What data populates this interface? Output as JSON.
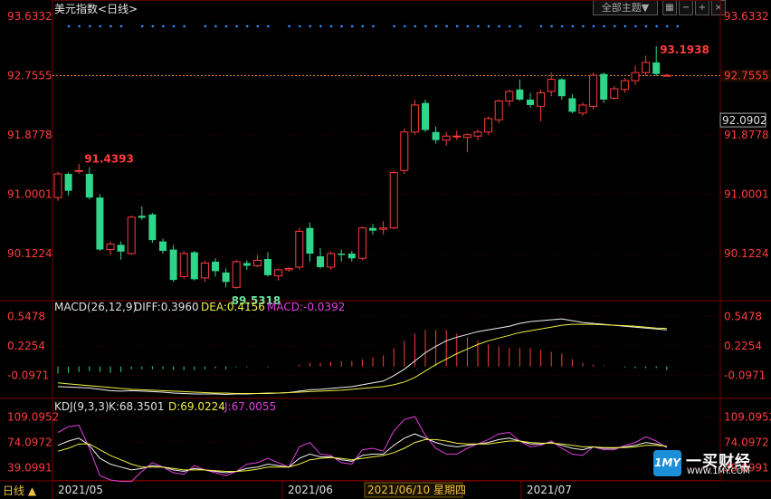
{
  "header": {
    "title": "美元指数",
    "period": "<日线>",
    "theme_button": "全部主题▼",
    "tool_icons": [
      "grid-icon",
      "minus-icon",
      "plus-icon",
      "close-icon"
    ]
  },
  "colors": {
    "up": "#ff3b3b",
    "down": "#2fd68a",
    "axis_text": "#ff3b3b",
    "grid": "#3a0000",
    "dot_markers": "#2f8fff",
    "diff_line": "#f0f0f0",
    "dea_line": "#f0f040",
    "j_line": "#e040e0",
    "last_price_line": "#e08a2a"
  },
  "chart_data": {
    "type": "candlestick",
    "main": {
      "y_labels": [
        "93.6332",
        "92.7555",
        "91.8778",
        "91.0001",
        "90.1224"
      ],
      "y_range": [
        89.45,
        93.6332
      ],
      "current_price": "92.7555",
      "reference_price": "92.0902",
      "high_annotation": "93.1938",
      "high_annotation_2": "91.4393",
      "low_annotation": "89.5318",
      "candles": [
        {
          "o": 90.95,
          "h": 91.33,
          "l": 90.9,
          "c": 91.3
        },
        {
          "o": 91.3,
          "h": 91.32,
          "l": 90.98,
          "c": 91.05
        },
        {
          "o": 91.35,
          "h": 91.45,
          "l": 91.3,
          "c": 91.35
        },
        {
          "o": 91.3,
          "h": 91.4,
          "l": 90.92,
          "c": 90.95
        },
        {
          "o": 90.95,
          "h": 91.0,
          "l": 90.16,
          "c": 90.18
        },
        {
          "o": 90.18,
          "h": 90.3,
          "l": 90.1,
          "c": 90.26
        },
        {
          "o": 90.25,
          "h": 90.3,
          "l": 90.03,
          "c": 90.15
        },
        {
          "o": 90.12,
          "h": 90.68,
          "l": 90.1,
          "c": 90.66
        },
        {
          "o": 90.68,
          "h": 90.82,
          "l": 90.62,
          "c": 90.65
        },
        {
          "o": 90.7,
          "h": 90.72,
          "l": 90.28,
          "c": 90.32
        },
        {
          "o": 90.3,
          "h": 90.34,
          "l": 90.12,
          "c": 90.16
        },
        {
          "o": 90.18,
          "h": 90.25,
          "l": 89.7,
          "c": 89.73
        },
        {
          "o": 89.78,
          "h": 90.16,
          "l": 89.75,
          "c": 90.12
        },
        {
          "o": 90.14,
          "h": 90.16,
          "l": 89.72,
          "c": 89.74
        },
        {
          "o": 89.76,
          "h": 90.02,
          "l": 89.7,
          "c": 89.98
        },
        {
          "o": 90.0,
          "h": 90.05,
          "l": 89.78,
          "c": 89.86
        },
        {
          "o": 89.84,
          "h": 89.9,
          "l": 89.62,
          "c": 89.7
        },
        {
          "o": 89.62,
          "h": 90.03,
          "l": 89.6,
          "c": 90.0
        },
        {
          "o": 89.98,
          "h": 90.02,
          "l": 89.88,
          "c": 89.94
        },
        {
          "o": 89.94,
          "h": 90.1,
          "l": 89.92,
          "c": 90.02
        },
        {
          "o": 90.04,
          "h": 90.14,
          "l": 89.78,
          "c": 89.8
        },
        {
          "o": 89.79,
          "h": 89.9,
          "l": 89.72,
          "c": 89.88
        },
        {
          "o": 89.88,
          "h": 89.92,
          "l": 89.85,
          "c": 89.9
        },
        {
          "o": 89.92,
          "h": 90.5,
          "l": 89.88,
          "c": 90.45
        },
        {
          "o": 90.5,
          "h": 90.58,
          "l": 90.0,
          "c": 90.12
        },
        {
          "o": 90.08,
          "h": 90.2,
          "l": 89.9,
          "c": 89.92
        },
        {
          "o": 89.92,
          "h": 90.15,
          "l": 89.88,
          "c": 90.12
        },
        {
          "o": 90.12,
          "h": 90.18,
          "l": 90.0,
          "c": 90.1
        },
        {
          "o": 90.12,
          "h": 90.16,
          "l": 90.0,
          "c": 90.05
        },
        {
          "o": 90.05,
          "h": 90.52,
          "l": 90.02,
          "c": 90.5
        },
        {
          "o": 90.5,
          "h": 90.56,
          "l": 90.4,
          "c": 90.46
        },
        {
          "o": 90.48,
          "h": 90.6,
          "l": 90.4,
          "c": 90.5
        },
        {
          "o": 90.5,
          "h": 91.35,
          "l": 90.48,
          "c": 91.32
        },
        {
          "o": 91.35,
          "h": 91.97,
          "l": 91.3,
          "c": 91.92
        },
        {
          "o": 91.92,
          "h": 92.4,
          "l": 91.88,
          "c": 92.32
        },
        {
          "o": 92.35,
          "h": 92.4,
          "l": 91.92,
          "c": 91.95
        },
        {
          "o": 91.92,
          "h": 92.0,
          "l": 91.75,
          "c": 91.8
        },
        {
          "o": 91.8,
          "h": 91.92,
          "l": 91.72,
          "c": 91.86
        },
        {
          "o": 91.86,
          "h": 91.94,
          "l": 91.8,
          "c": 91.86
        },
        {
          "o": 91.84,
          "h": 91.9,
          "l": 91.62,
          "c": 91.88
        },
        {
          "o": 91.86,
          "h": 91.96,
          "l": 91.8,
          "c": 91.92
        },
        {
          "o": 91.92,
          "h": 92.15,
          "l": 91.88,
          "c": 92.12
        },
        {
          "o": 92.1,
          "h": 92.4,
          "l": 92.05,
          "c": 92.38
        },
        {
          "o": 92.38,
          "h": 92.55,
          "l": 92.3,
          "c": 92.52
        },
        {
          "o": 92.55,
          "h": 92.7,
          "l": 92.38,
          "c": 92.4
        },
        {
          "o": 92.4,
          "h": 92.5,
          "l": 92.28,
          "c": 92.32
        },
        {
          "o": 92.3,
          "h": 92.55,
          "l": 92.08,
          "c": 92.5
        },
        {
          "o": 92.52,
          "h": 92.8,
          "l": 92.45,
          "c": 92.7
        },
        {
          "o": 92.7,
          "h": 92.72,
          "l": 92.4,
          "c": 92.45
        },
        {
          "o": 92.42,
          "h": 92.48,
          "l": 92.2,
          "c": 92.22
        },
        {
          "o": 92.2,
          "h": 92.36,
          "l": 92.16,
          "c": 92.32
        },
        {
          "o": 92.3,
          "h": 92.8,
          "l": 92.25,
          "c": 92.76
        },
        {
          "o": 92.78,
          "h": 92.8,
          "l": 92.35,
          "c": 92.4
        },
        {
          "o": 92.42,
          "h": 92.6,
          "l": 92.4,
          "c": 92.56
        },
        {
          "o": 92.55,
          "h": 92.72,
          "l": 92.5,
          "c": 92.68
        },
        {
          "o": 92.68,
          "h": 92.9,
          "l": 92.62,
          "c": 92.8
        },
        {
          "o": 92.8,
          "h": 93.05,
          "l": 92.75,
          "c": 92.95
        },
        {
          "o": 92.95,
          "h": 93.19,
          "l": 92.75,
          "c": 92.78
        },
        {
          "o": 92.76,
          "h": 92.78,
          "l": 92.74,
          "c": 92.76
        }
      ]
    },
    "macd": {
      "label": "MACD(26,12,9)",
      "diff_label": "DIFF:0.3960",
      "dea_label": "DEA:0.4156",
      "macd_label": "MACD:-0.0392",
      "y_labels": [
        "0.5478",
        "0.2254",
        "-0.0971"
      ],
      "y_range": [
        -0.32,
        0.58
      ],
      "diff": [
        -0.22,
        -0.225,
        -0.23,
        -0.235,
        -0.25,
        -0.265,
        -0.27,
        -0.265,
        -0.27,
        -0.275,
        -0.28,
        -0.29,
        -0.295,
        -0.3,
        -0.3,
        -0.3,
        -0.305,
        -0.3,
        -0.3,
        -0.295,
        -0.295,
        -0.29,
        -0.285,
        -0.27,
        -0.255,
        -0.25,
        -0.24,
        -0.23,
        -0.22,
        -0.2,
        -0.18,
        -0.16,
        -0.1,
        -0.03,
        0.06,
        0.15,
        0.22,
        0.28,
        0.32,
        0.35,
        0.38,
        0.4,
        0.42,
        0.44,
        0.47,
        0.49,
        0.5,
        0.51,
        0.52,
        0.5,
        0.48,
        0.47,
        0.46,
        0.45,
        0.44,
        0.43,
        0.42,
        0.41,
        0.4
      ],
      "dea": [
        -0.18,
        -0.19,
        -0.2,
        -0.21,
        -0.22,
        -0.23,
        -0.24,
        -0.25,
        -0.255,
        -0.26,
        -0.265,
        -0.27,
        -0.275,
        -0.28,
        -0.285,
        -0.29,
        -0.29,
        -0.295,
        -0.295,
        -0.295,
        -0.29,
        -0.29,
        -0.285,
        -0.28,
        -0.275,
        -0.27,
        -0.265,
        -0.26,
        -0.25,
        -0.24,
        -0.23,
        -0.22,
        -0.2,
        -0.17,
        -0.12,
        -0.05,
        0.02,
        0.08,
        0.14,
        0.19,
        0.24,
        0.28,
        0.31,
        0.34,
        0.37,
        0.39,
        0.41,
        0.43,
        0.45,
        0.46,
        0.46,
        0.46,
        0.455,
        0.45,
        0.445,
        0.44,
        0.43,
        0.42,
        0.416
      ],
      "hist": [
        -0.08,
        -0.07,
        -0.06,
        -0.05,
        -0.06,
        -0.07,
        -0.06,
        -0.03,
        -0.03,
        -0.03,
        -0.03,
        -0.04,
        -0.04,
        -0.04,
        -0.03,
        -0.02,
        -0.03,
        -0.01,
        -0.01,
        0.0,
        -0.01,
        0.0,
        0.0,
        0.02,
        0.04,
        0.04,
        0.05,
        0.06,
        0.06,
        0.08,
        0.1,
        0.12,
        0.2,
        0.28,
        0.36,
        0.4,
        0.4,
        0.4,
        0.36,
        0.32,
        0.28,
        0.24,
        0.22,
        0.2,
        0.2,
        0.2,
        0.18,
        0.16,
        0.14,
        0.08,
        0.04,
        0.02,
        0.01,
        0.0,
        -0.01,
        -0.02,
        -0.02,
        -0.02,
        -0.04
      ]
    },
    "kdj": {
      "label": "KDJ(9,3,3)",
      "k_label": "K:68.3501",
      "d_label": "D:69.0224",
      "j_label": "J:67.0055",
      "y_labels": [
        "109.0952",
        "74.0972",
        "39.0991"
      ],
      "y_range": [
        22,
        115
      ],
      "k": [
        70,
        76,
        80,
        70,
        52,
        44,
        40,
        36,
        38,
        42,
        40,
        36,
        34,
        38,
        36,
        34,
        32,
        34,
        38,
        40,
        44,
        42,
        40,
        52,
        58,
        54,
        54,
        50,
        48,
        56,
        58,
        58,
        70,
        80,
        86,
        80,
        74,
        70,
        68,
        70,
        72,
        74,
        78,
        80,
        76,
        72,
        72,
        74,
        70,
        66,
        64,
        68,
        66,
        66,
        68,
        70,
        74,
        72,
        68
      ],
      "d": [
        62,
        66,
        72,
        72,
        64,
        56,
        50,
        44,
        40,
        40,
        40,
        38,
        36,
        36,
        36,
        35,
        34,
        34,
        35,
        37,
        40,
        40,
        40,
        44,
        50,
        52,
        53,
        52,
        50,
        52,
        54,
        56,
        60,
        66,
        74,
        78,
        78,
        76,
        73,
        72,
        72,
        72,
        74,
        76,
        76,
        74,
        73,
        73,
        72,
        70,
        68,
        68,
        67,
        67,
        67,
        68,
        70,
        70,
        69
      ],
      "j": [
        88,
        96,
        98,
        66,
        28,
        22,
        20,
        20,
        34,
        46,
        40,
        32,
        30,
        42,
        36,
        32,
        28,
        34,
        44,
        46,
        52,
        46,
        40,
        68,
        74,
        58,
        56,
        46,
        44,
        64,
        66,
        62,
        90,
        106,
        110,
        84,
        66,
        58,
        58,
        66,
        72,
        78,
        86,
        88,
        76,
        68,
        70,
        76,
        66,
        58,
        56,
        68,
        64,
        64,
        70,
        74,
        82,
        76,
        67
      ]
    },
    "x_labels": [
      "2021/05",
      "2021/06",
      "2021/07"
    ],
    "crosshair_label": "2021/06/10 星期四",
    "grid": true
  },
  "footer": {
    "period_selector": "日线 ▲"
  },
  "watermark": {
    "badge": "1MY",
    "name": "一买财经",
    "url": "WWW.1MY.COM"
  }
}
